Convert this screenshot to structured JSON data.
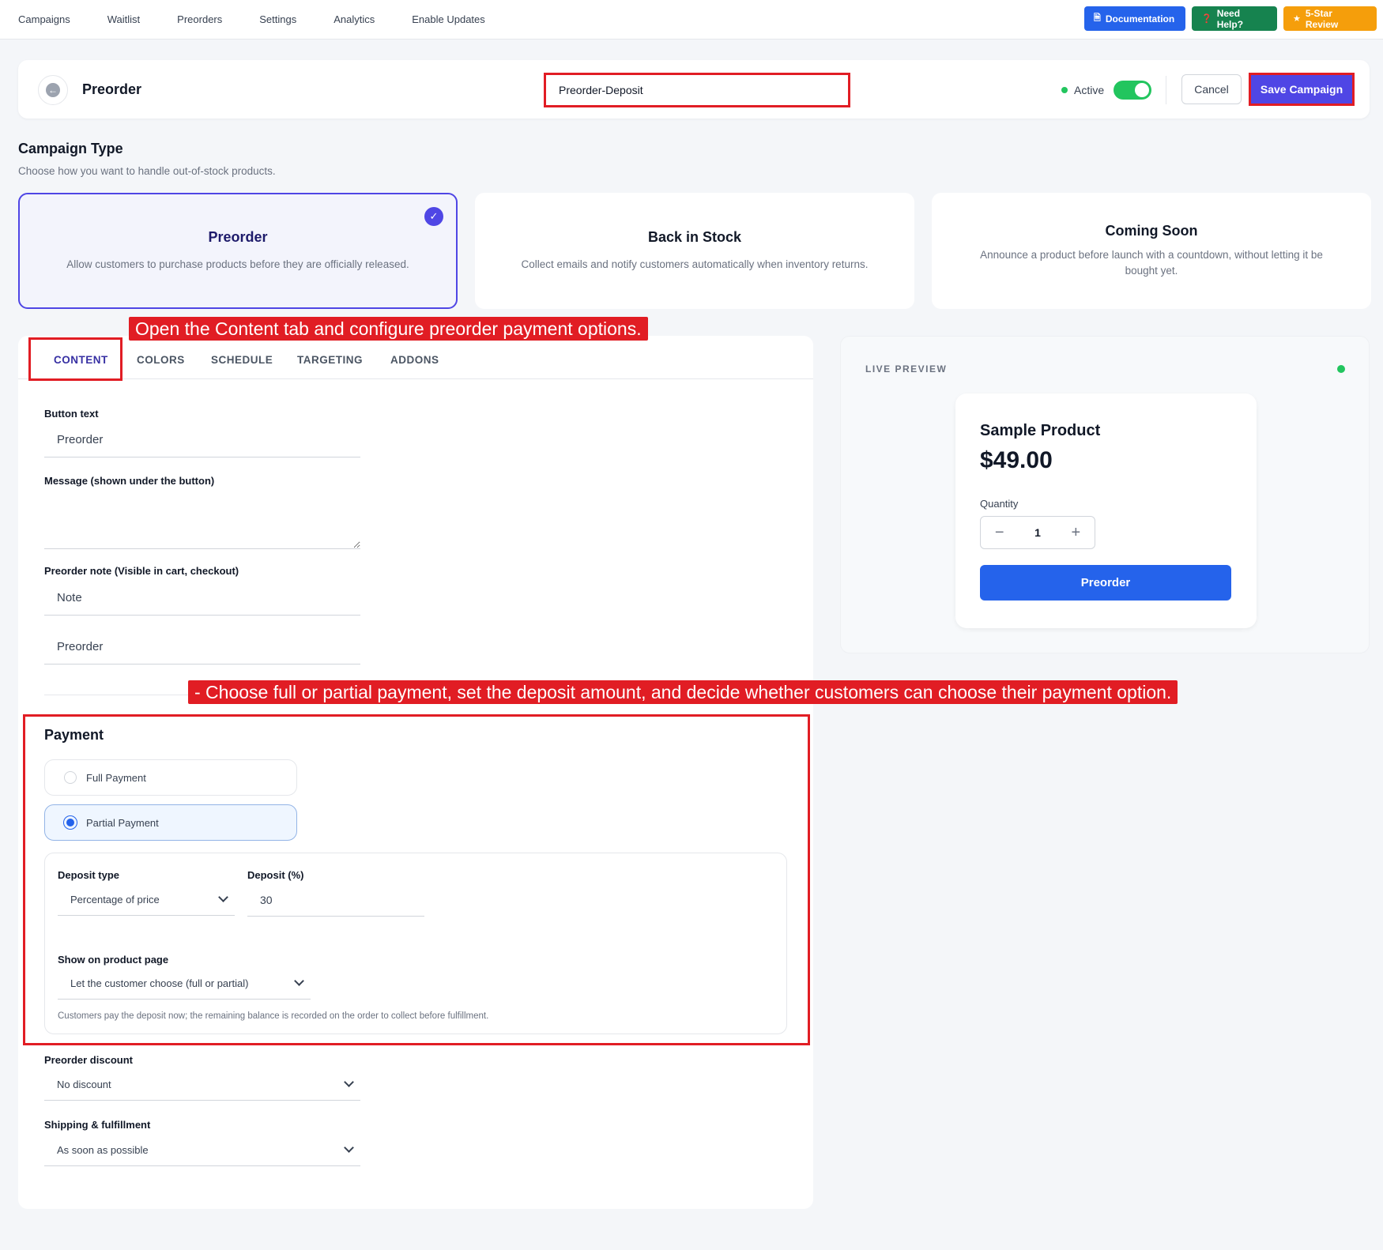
{
  "nav": {
    "links": [
      "Campaigns",
      "Waitlist",
      "Preorders",
      "Settings",
      "Analytics",
      "Enable Updates"
    ],
    "documentation": "Documentation",
    "need_help": "Need Help?",
    "review": "5-Star Review"
  },
  "header": {
    "title": "Preorder",
    "campaign_name": "Preorder-Deposit",
    "active_label": "Active",
    "active": true,
    "cancel": "Cancel",
    "save": "Save Campaign"
  },
  "campaign_type": {
    "title": "Campaign Type",
    "subtitle": "Choose how you want to handle out-of-stock products.",
    "options": [
      {
        "title": "Preorder",
        "desc": "Allow customers to purchase products before they are officially released.",
        "selected": true
      },
      {
        "title": "Back in Stock",
        "desc": "Collect emails and notify customers automatically when inventory returns.",
        "selected": false
      },
      {
        "title": "Coming Soon",
        "desc": "Announce a product before launch with a countdown, without letting it be bought yet.",
        "selected": false
      }
    ]
  },
  "annotations": {
    "content_tab": "Open the Content tab and configure preorder payment options.",
    "payment": "- Choose full or partial payment, set the deposit amount, and decide whether customers can choose their payment option."
  },
  "tabs": [
    "CONTENT",
    "COLORS",
    "SCHEDULE",
    "TARGETING",
    "ADDONS"
  ],
  "content": {
    "button_text_label": "Button text",
    "button_text_value": "Preorder",
    "message_label": "Message (shown under the button)",
    "note_label": "Preorder note (Visible in cart, checkout)",
    "note_value": "Note",
    "note_text_value": "Preorder"
  },
  "payment": {
    "title": "Payment",
    "full": "Full Payment",
    "partial": "Partial Payment",
    "selected": "partial",
    "deposit_type_label": "Deposit type",
    "deposit_type_value": "Percentage of price",
    "deposit_label": "Deposit (%)",
    "deposit_value": "30",
    "show_label": "Show on product page",
    "show_value": "Let the customer choose (full or partial)",
    "hint": "Customers pay the deposit now; the remaining balance is recorded on the order to collect before fulfillment."
  },
  "discount": {
    "label": "Preorder discount",
    "value": "No discount"
  },
  "shipping": {
    "label": "Shipping & fulfillment",
    "value": "As soon as possible"
  },
  "preview": {
    "label": "LIVE PREVIEW",
    "product_name": "Sample Product",
    "price": "$49.00",
    "quantity_label": "Quantity",
    "quantity": "1",
    "button": "Preorder"
  },
  "colors": {
    "accent": "#4f46e5",
    "primary_blue": "#2563eb",
    "annotation_red": "#e11d24",
    "active_green": "#22c55e"
  }
}
